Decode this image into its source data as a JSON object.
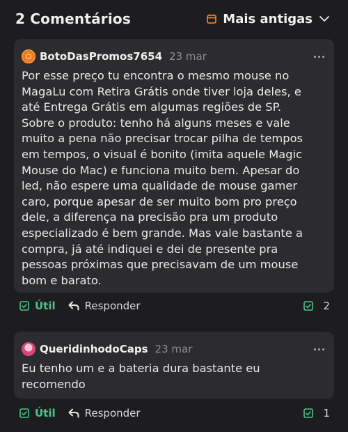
{
  "header": {
    "title": "2 Comentários",
    "sort_label": "Mais antigas"
  },
  "comments": [
    {
      "author": "BotoDasPromos7654",
      "date": "23 mar",
      "text": "Por esse preço tu encontra o mesmo mouse no\nMagaLu com Retira Grátis onde tiver loja deles, e\naté Entrega Grátis em algumas regiões de SP.\nSobre o produto: tenho há alguns meses e vale\nmuito a pena não precisar trocar pilha de tempos\nem tempos, o visual é bonito (imita aquele Magic\nMouse do Mac) e funciona muito bem. Apesar do\nled, não espere uma qualidade de mouse gamer\ncaro, porque apesar de ser muito bom pro preço\ndele, a diferença na precisão pra um produto\nespecializado é bem grande. Mas vale bastante a\ncompra, já até indiquei e dei de presente pra\npessoas próximas que precisavam de um mouse\nbom e barato.",
      "useful_label": "Útil",
      "reply_label": "Responder",
      "useful_count": "2"
    },
    {
      "author": "QueridinhodoCaps",
      "date": "23 mar",
      "text": "Eu tenho um e a bateria dura bastante eu\nrecomendo",
      "useful_label": "Útil",
      "reply_label": "Responder",
      "useful_count": "1"
    }
  ],
  "colors": {
    "background": "#1d1d1f",
    "card": "#2c2c2e",
    "accent_orange": "#f07a1a",
    "useful_green": "#4cc38a"
  },
  "icons": [
    "calendar-icon",
    "chevron-down-icon",
    "more-dots-icon",
    "checkbox-check-icon",
    "reply-arrow-icon"
  ]
}
